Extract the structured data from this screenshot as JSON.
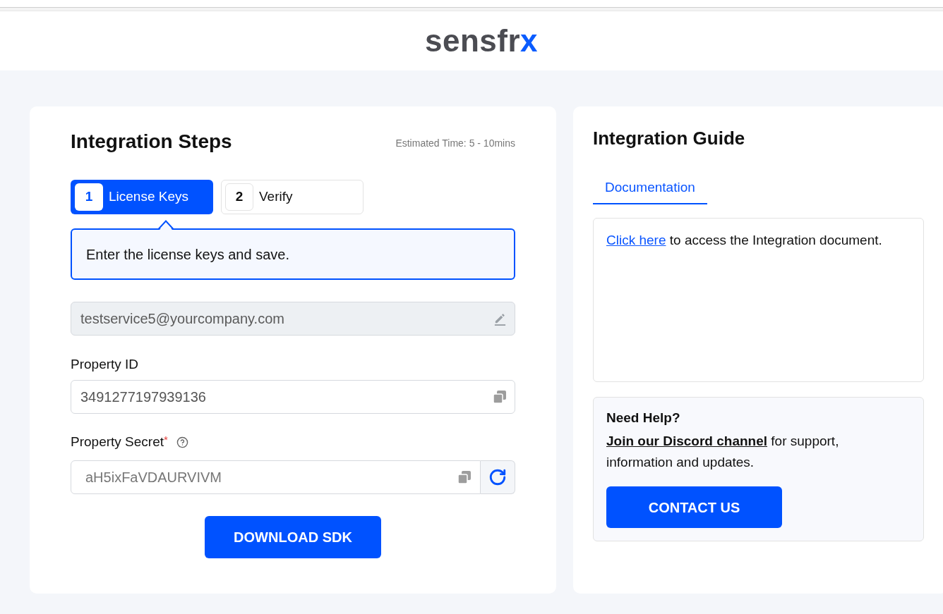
{
  "header": {
    "logo": "sensfrx"
  },
  "steps_card": {
    "title": "Integration Steps",
    "estimate": "Estimated Time: 5 - 10mins",
    "steps": [
      {
        "number": "1",
        "label": "License Keys",
        "selected": true
      },
      {
        "number": "2",
        "label": "Verify",
        "selected": false
      }
    ],
    "instruction": "Enter the license keys and save.",
    "fields": [
      {
        "kind": "edit",
        "disabled": true,
        "value": "testservice5@yourcompany.com"
      },
      {
        "kind": "copy",
        "disabled": false,
        "label": "Property ID",
        "value": "3491277197939136"
      },
      {
        "kind": "secret",
        "disabled": false,
        "label": "Property Secret",
        "required_mark": "*",
        "value": "aH5ixFaVDAURVIVM"
      }
    ],
    "button": "DOWNLOAD SDK"
  },
  "guide_card": {
    "title": "Integration Guide",
    "tabs": [
      {
        "label": "Documentation",
        "selected": true
      }
    ],
    "document": {
      "link": "Click here",
      "text": "to access the Integration document."
    },
    "help": {
      "title": "Need Help?",
      "link": "Join our Discord channel",
      "text": "for support, information and updates.",
      "button": "CONTACT US"
    }
  }
}
